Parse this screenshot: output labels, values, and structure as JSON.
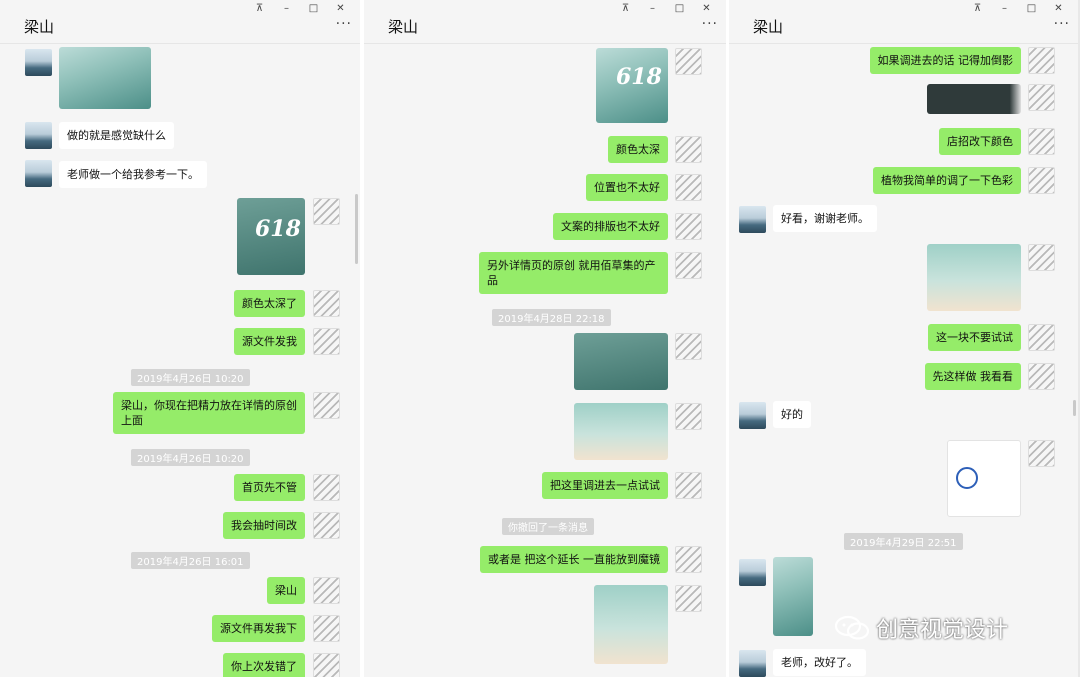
{
  "panels": [
    {
      "title": "梁山",
      "window_buttons": [
        "⊼",
        "–",
        "□",
        "✕"
      ],
      "more": "···",
      "messages": [
        {
          "kind": "image"
        },
        {
          "kind": "text",
          "text": "做的就是感觉缺什么"
        },
        {
          "kind": "text",
          "text": "老师做一个给我参考一下。"
        },
        {
          "kind": "image",
          "overlay": "618"
        },
        {
          "kind": "text",
          "text": "颜色太深了"
        },
        {
          "kind": "text",
          "text": "源文件发我"
        },
        {
          "kind": "time",
          "text": "2019年4月26日 10:20"
        },
        {
          "kind": "text",
          "text": "梁山，你现在把精力放在详情的原创上面"
        },
        {
          "kind": "time",
          "text": "2019年4月26日 10:20"
        },
        {
          "kind": "text",
          "text": "首页先不管"
        },
        {
          "kind": "text",
          "text": "我会抽时间改"
        },
        {
          "kind": "time",
          "text": "2019年4月26日 16:01"
        },
        {
          "kind": "text",
          "text": "梁山"
        },
        {
          "kind": "text",
          "text": "源文件再发我下"
        },
        {
          "kind": "text",
          "text": "你上次发错了"
        }
      ]
    },
    {
      "title": "梁山",
      "window_buttons": [
        "⊼",
        "–",
        "□",
        "✕"
      ],
      "more": "···",
      "messages": [
        {
          "kind": "image",
          "overlay": "618"
        },
        {
          "kind": "text",
          "text": "颜色太深"
        },
        {
          "kind": "text",
          "text": "位置也不太好"
        },
        {
          "kind": "text",
          "text": "文案的排版也不太好"
        },
        {
          "kind": "text",
          "text": "另外详情页的原创  就用佰草集的产品"
        },
        {
          "kind": "time",
          "text": "2019年4月28日 22:18"
        },
        {
          "kind": "image"
        },
        {
          "kind": "image"
        },
        {
          "kind": "text",
          "text": "把这里调进去一点试试"
        },
        {
          "kind": "time",
          "text": "你撤回了一条消息"
        },
        {
          "kind": "text",
          "text": "或者是 把这个延长  一直能放到魔镜"
        },
        {
          "kind": "image"
        }
      ]
    },
    {
      "title": "梁山",
      "window_buttons": [
        "⊼",
        "–",
        "□",
        "✕"
      ],
      "more": "···",
      "messages": [
        {
          "kind": "text",
          "text": "如果调进去的话  记得加倒影"
        },
        {
          "kind": "image"
        },
        {
          "kind": "text",
          "text": "店招改下颜色"
        },
        {
          "kind": "text",
          "text": "植物我简单的调了一下色彩"
        },
        {
          "kind": "text",
          "text": "好看，谢谢老师。"
        },
        {
          "kind": "image"
        },
        {
          "kind": "text",
          "text": "这一块不要试试"
        },
        {
          "kind": "text",
          "text": "先这样做  我看看"
        },
        {
          "kind": "text",
          "text": "好的"
        },
        {
          "kind": "image"
        },
        {
          "kind": "time",
          "text": "2019年4月29日 22:51"
        },
        {
          "kind": "image"
        },
        {
          "kind": "text",
          "text": "老师，改好了。"
        }
      ]
    }
  ],
  "watermark": {
    "icon": "wechat-official-account-icon",
    "text": "创意视觉设计"
  },
  "colors": {
    "self_bubble": "#95ec69",
    "other_bubble": "#ffffff",
    "background": "#f5f5f5"
  }
}
